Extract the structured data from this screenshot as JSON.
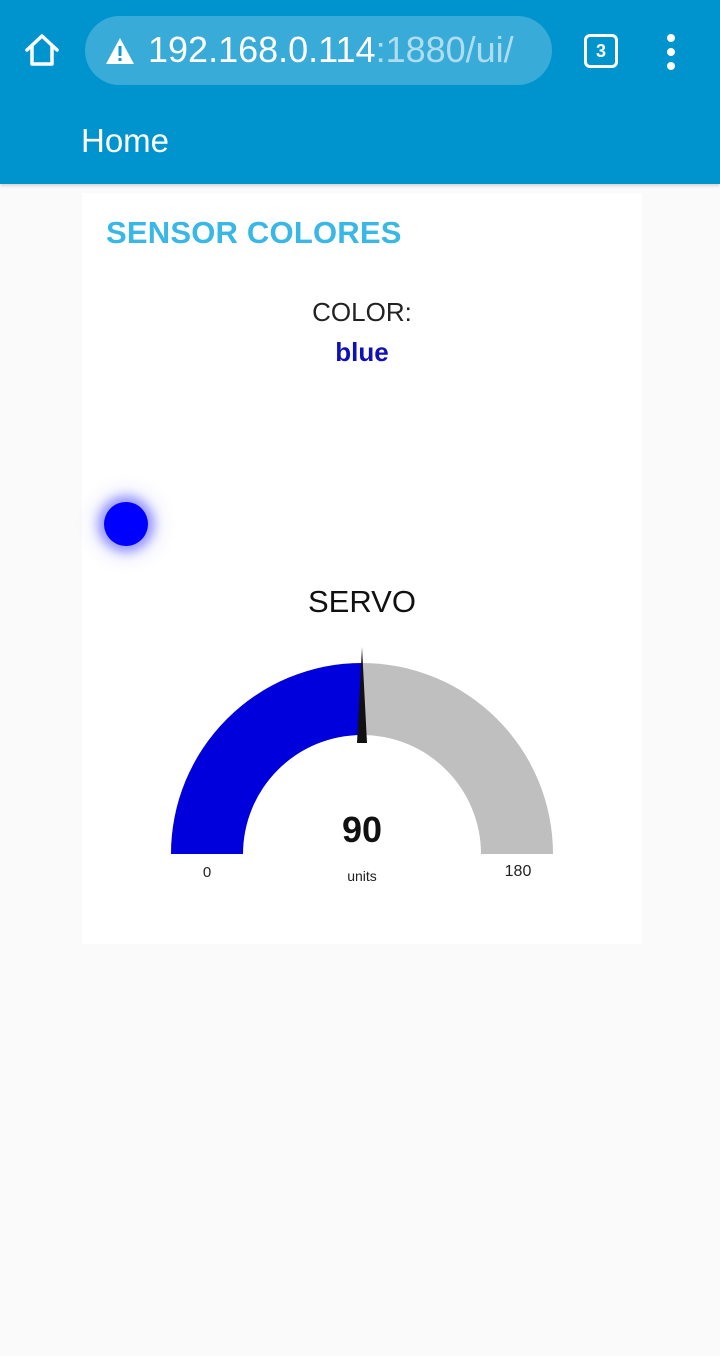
{
  "browser": {
    "url_host": "192.168.0.114",
    "url_path": ":1880/ui/",
    "tab_count": "3",
    "home_icon": "home-icon",
    "warning_icon": "warning-icon",
    "menu_icon": "more-vert-icon"
  },
  "toolbar": {
    "title": "Home"
  },
  "group": {
    "title": "SENSOR COLORES"
  },
  "color_widget": {
    "label": "COLOR:",
    "value": "blue",
    "value_color": "#1010b8",
    "led_color": "#0000ff"
  },
  "servo": {
    "title": "SERVO",
    "value": 90,
    "value_text": "90",
    "units": "units",
    "min": 0,
    "max": 180,
    "min_label": "0",
    "max_label": "180",
    "fill_color": "#0000dd",
    "track_color": "#bfbfbf",
    "needle_color": "#111111"
  },
  "colors": {
    "toolbar": "#0094ce",
    "accent": "#39b7e6",
    "background": "#fafafa"
  }
}
